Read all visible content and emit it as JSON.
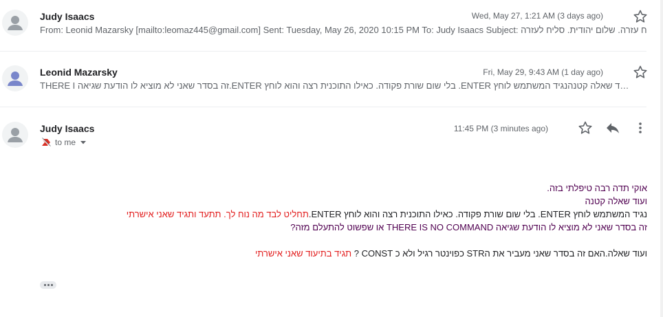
{
  "messages": [
    {
      "sender": "Judy Isaacs",
      "date": "Wed, May 27, 1:21 AM (3 days ago)",
      "snippet": "From: Leonid Mazarsky [mailto:leomaz445@gmail.com] Sent: Tuesday, May 26, 2020 10:15 PM To: Judy Isaacs Subject: סליח עזרה. שלום יהודית. סליח לעזרה…",
      "avatar_icon": "person-icon",
      "avatar_color": "#9aa0a6"
    },
    {
      "sender": "Leonid Mazarsky",
      "date": "Fri, May 29, 9:43 AM (1 day ago)",
      "snippet": "…ד שאלה קטנהנגיד המשתמש לוחץ ENTER. בלי שום שורת פקודה. כאילו התוכנית רצה והוא לוחץ ENTER.זה בסדר שאני לא מוציא לו הודעת שגיאה THERE I",
      "avatar_icon": "person-icon",
      "avatar_color": "#7986cb"
    }
  ],
  "open_message": {
    "sender": "Judy Isaacs",
    "date": "11:45 PM (3 minutes ago)",
    "to_label": "to me",
    "avatar_icon": "person-icon",
    "avatar_color": "#9aa0a6",
    "important_icon": "important-marker-icon",
    "lines": {
      "l1": "אוקי תדה רבה טיפלתי בזה.",
      "l2": "ועוד שאלה קטנה",
      "l3_a": "נגיד המשתמש לוחץ ENTER. בלי שום שורת פקודה. כאילו התוכנית רצה והוא לוחץ ENTER.",
      "l3_b": "תחליט לבד מה נוח לך. תתעד ותגיד שאני אישרתי",
      "l4": "זה בסדר שאני לא מוציא לו הודעת שגיאה THERE IS NO COMMAND או שפשוט להתעלם מזה?",
      "l5_a": "ועוד שאלה.האם זה בסדר שאני מעביר את הSTR כפוינטר רגיל ולא כ CONST ? ",
      "l5_b": "תגיד בתיעוד שאני אישרתי"
    }
  },
  "icons": {
    "star": "star-icon",
    "reply": "reply-icon",
    "more": "more-vert-icon",
    "expand": "ellipsis-icon",
    "caret": "caret-down-icon"
  },
  "colors": {
    "quoted_text": "#500050",
    "highlight_red": "#e21d1d",
    "important_red": "#d93025"
  }
}
